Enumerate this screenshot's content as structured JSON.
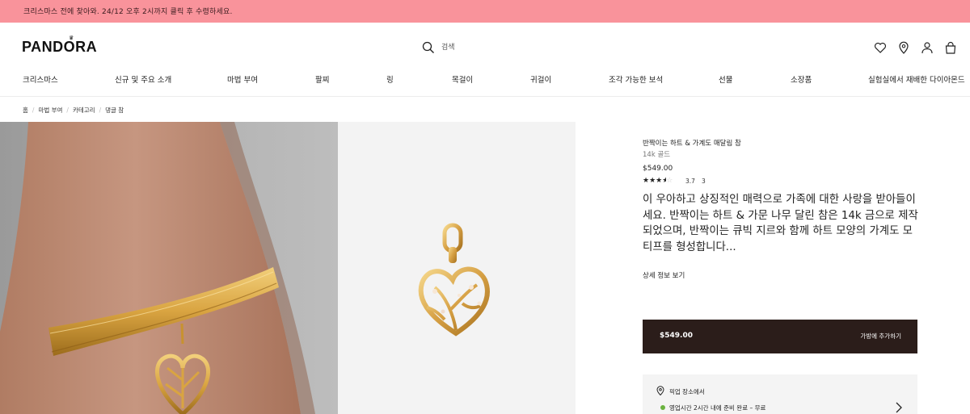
{
  "promo": {
    "text": "크리스마스 전에 찾아와. 24/12 오후 2시까지 클릭 후 수령하세요."
  },
  "header": {
    "logo": "PANDORA",
    "search_placeholder": "검색",
    "icons": [
      "heart-icon",
      "location-pin-icon",
      "user-icon",
      "shopping-bag-icon"
    ]
  },
  "nav": {
    "items": [
      "크리스마스",
      "신규 및 주요 소개",
      "마법 부여",
      "팔찌",
      "링",
      "목걸이",
      "귀걸이",
      "조각 가능한 보석",
      "선물",
      "소장품",
      "실험실에서 재배한 다이아몬드"
    ]
  },
  "breadcrumb": [
    "홈",
    "마법 부여",
    "카테고리",
    "댕글 참"
  ],
  "product": {
    "title": "반짝이는 하트 & 가계도 매달림 참",
    "metal": "14k 골드",
    "price": "$549.00",
    "rating": 3.7,
    "rating_text": "3.7",
    "review_count": "3",
    "description": "이 우아하고 상징적인 매력으로 가족에 대한 사랑을 받아들이세요. 반짝이는 하트 & 가문 나무 달린 참은 14k 금으로 제작되었으며, 반짝이는 큐빅 지르와 함께 하트 모양의 가계도 모티프를 형성합니다...",
    "details_link": "상세 정보 보기"
  },
  "cart": {
    "price": "$549.00",
    "label": "가방에 추가하기"
  },
  "pickup": {
    "title": "픽업 장소에서",
    "status": "영업시간 2시간 내에 준비 완료 – 무료"
  },
  "colors": {
    "promo_bg": "#f9939b",
    "cart_bg": "#2b1d1a",
    "status_green": "#6ab23f",
    "gold": "#d9a441"
  }
}
